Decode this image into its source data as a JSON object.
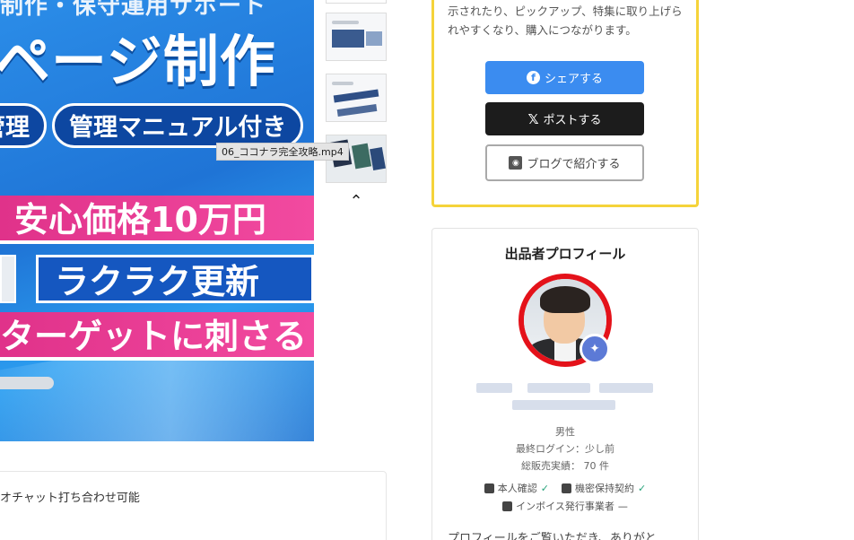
{
  "hero": {
    "top_text": "制作・保守運用サポート",
    "title": "ページ制作",
    "tag1": "管理",
    "tag2": "管理マニュアル付き",
    "stripe1": "安心価格10万円",
    "stripe2": "ラクラク更新",
    "stripe3": "ターゲットに刺さる"
  },
  "thumbnails": {
    "chevron_up": "⌃"
  },
  "tooltip": {
    "text": "06_ココナラ完全攻略.mp4"
  },
  "chat": {
    "text": "オチャット打ち合わせ可能"
  },
  "share": {
    "description": "示されたり、ピックアップ、特集に取り上げられやすくなり、購入につながります。",
    "facebook_label": "シェアする",
    "x_label": "ポストする",
    "blog_label": "ブログで紹介する",
    "facebook_color": "#3b8cf0",
    "x_color": "#1c1c1c",
    "highlight_border_color": "#f5d33a"
  },
  "profile": {
    "title": "出品者プロフィール",
    "gender": "男性",
    "last_login": "最終ログイン：少し前",
    "total_sales": "総販売実績： 70 件",
    "identity_verified": "本人確認",
    "nda": "機密保持契約",
    "invoice": "インボイス発行事業者",
    "bottom_text": "プロフィールをご覧いただき、ありがと",
    "avatar_ring_color": "#e4121a",
    "check_color": "#27a37a"
  }
}
